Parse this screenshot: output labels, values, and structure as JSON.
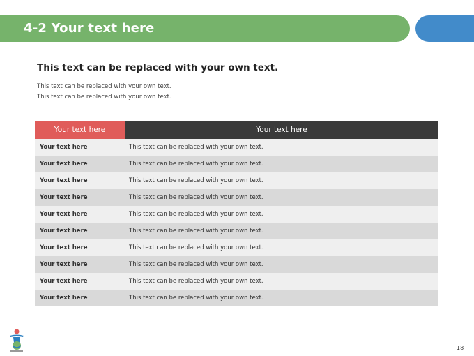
{
  "title": "4-2 Your text here",
  "heading": "This text can be replaced with your own text.",
  "body_lines": [
    "This text can be replaced with your own text.",
    "This text can be replaced with your own text."
  ],
  "table": {
    "headers": [
      "Your text here",
      "Your text here"
    ],
    "rows": [
      [
        "Your text here",
        "This text can be replaced with your own text."
      ],
      [
        "Your text here",
        "This text can be replaced with your own text."
      ],
      [
        "Your text here",
        "This text can be replaced with your own text."
      ],
      [
        "Your text here",
        "This text can be replaced with your own text."
      ],
      [
        "Your text here",
        "This text can be replaced with your own text."
      ],
      [
        "Your text here",
        "This text can be replaced with your own text."
      ],
      [
        "Your text here",
        "This text can be replaced with your own text."
      ],
      [
        "Your text here",
        "This text can be replaced with your own text."
      ],
      [
        "Your text here",
        "This text can be replaced with your own text."
      ],
      [
        "Your text here",
        "This text can be replaced with your own text."
      ]
    ]
  },
  "page_number": "18",
  "colors": {
    "title_bar": "#76b36b",
    "accent_blue": "#428bca",
    "header_red": "#e05c5a",
    "header_dark": "#3a3a3a"
  },
  "icons": {
    "logo": "mascot-logo-icon"
  }
}
